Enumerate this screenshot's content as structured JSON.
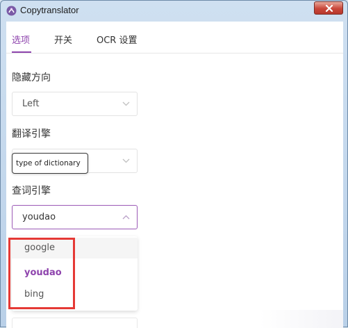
{
  "window": {
    "title": "Copytranslator"
  },
  "tabs": [
    {
      "label": "选项",
      "active": true
    },
    {
      "label": "开关",
      "active": false
    },
    {
      "label": "OCR 设置",
      "active": false
    }
  ],
  "settings": {
    "hide_direction": {
      "label": "隐藏方向",
      "value": "Left"
    },
    "translate_engine": {
      "label": "翻译引擎",
      "tooltip": "type of dictionary"
    },
    "dict_engine": {
      "label": "查词引擎",
      "value": "youdao",
      "options": [
        {
          "label": "google",
          "selected": false
        },
        {
          "label": "youdao",
          "selected": true
        },
        {
          "label": "bing",
          "selected": false
        }
      ]
    }
  },
  "colors": {
    "accent": "#8e44ad",
    "annotation_box": "#e53935"
  }
}
